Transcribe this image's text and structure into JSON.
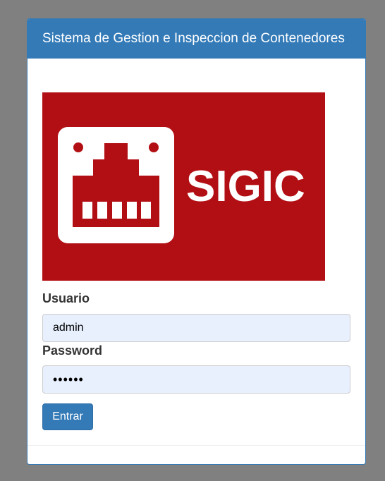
{
  "panel": {
    "title": "Sistema de Gestion e Inspeccion de Contenedores"
  },
  "logo": {
    "text": "SIGIC",
    "bg_color": "#b20f14",
    "icon": "ethernet-port-icon"
  },
  "form": {
    "usuario_label": "Usuario",
    "usuario_value": "admin",
    "password_label": "Password",
    "password_value": "••••••",
    "submit_label": "Entrar"
  },
  "colors": {
    "primary": "#337ab7",
    "background": "#808080",
    "input_bg": "#e8f0fe"
  }
}
